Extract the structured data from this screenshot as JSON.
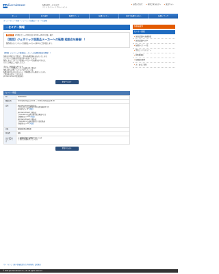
{
  "header": {
    "logo_mark": "JAC",
    "logo_text": "Recruitment",
    "tagline": [
      "転職支援サービスのJAC",
      "ジェイ エイ シー リクルートメント"
    ],
    "links": [
      "お問い合わせ",
      "採用ご担当の方へ",
      "英語サイト"
    ]
  },
  "gnav": [
    "ホーム",
    "求人検索",
    "転職サポート",
    "転職セミナー",
    "初めて転職する方へ",
    "転職ノウハウ"
  ],
  "breadcrumb": "ホーム > セミナー情報 > ジェネリック医薬品メーカーへの転職",
  "main": {
    "page_title": "－セミナー情報",
    "lead": {
      "badge": "開催日時",
      "date": "2月8日(土) ～ 2月9日(日) 13:00～16:00",
      "place": "大阪・神戸",
      "title": "【関西】ジェネリック医薬品メーカーへの転職 相談会を開催！！",
      "sub": "関西地方のジェネリック医薬品メーカーの求人をご案内致します。"
    },
    "detail_title": "【関西】ジェネリック医薬品メーカーへの転職 相談会を開催！！",
    "body": [
      "医薬品の開発から営業まで、業界の転職情報をお伝えいたします。",
      "ジェネリック医薬品の需要が年々高まっています。",
      "関西にあるジェネリック医薬品メーカーへの転職をお考えの方、",
      "ぜひこの機会にご相談ください。",
      "",
      "当日は、個別相談も承ります。",
      "ジェネリック医薬品メーカーの最新の求人動向や",
      "業界の給与水準についてもご紹介いたします。",
      "転職を検討中の方はもちろん、情報収集の方も歓迎いたします。",
      "ご参加をお待ちしております。",
      "JAC Recruitment 医薬品担当"
    ],
    "button_label": "参加申し込み",
    "overview": {
      "head": "セミナー概要",
      "rows": {
        "no_label": "No",
        "no_value": "000000000",
        "datetime_label": "開催日時",
        "datetime_value": "2014年2月8日(土)13:00 ～ 2014年2月9日(日)16:00",
        "venue_label": "会場",
        "venue1": [
          "JAC Recruitment 神戸支店",
          "〒650-0001 兵庫県神戸市中央区加納町4丁目",
          "JAC神戸ビル 5F",
          "[地図]"
        ],
        "venue2": [
          "JAC Recruitment 大阪支店",
          "〒530-0001 大阪府大阪市北区梅田1丁目",
          "大阪駅前ビル 10F",
          "[地図]"
        ],
        "venue3": [
          "JAC Recruitment 京都支店",
          "〒600-8001 京都府京都市下京区四条通",
          "京都四条ビル 3F",
          "[地図]"
        ],
        "target_label": "対象",
        "target_value": "医薬品業界の経験者",
        "fee_label": "参加費",
        "fee_value": "無料",
        "recommend_label": "こんな方にオススメです",
        "recommend_values": [
          "□ 医薬品業界で転職を考えている方",
          "□ 関西で転職を考えている方"
        ]
      }
    }
  },
  "sidebar": {
    "head1": "医薬品業界",
    "head2": "セミナー情報",
    "items": [
      "医薬品業界の転職事情",
      "医薬品業界の求人",
      "転職セミナー一覧",
      "関西エリアのセミナー",
      "個別相談会",
      "転職成功事例",
      "よくあるご質問"
    ]
  },
  "footer": {
    "links": "サイトマップ | 個人情報保護方針 | 利用規約 | 会社概要",
    "copyright": "© 2014 JAC Recruitment Co., Ltd. All rights reserved."
  }
}
